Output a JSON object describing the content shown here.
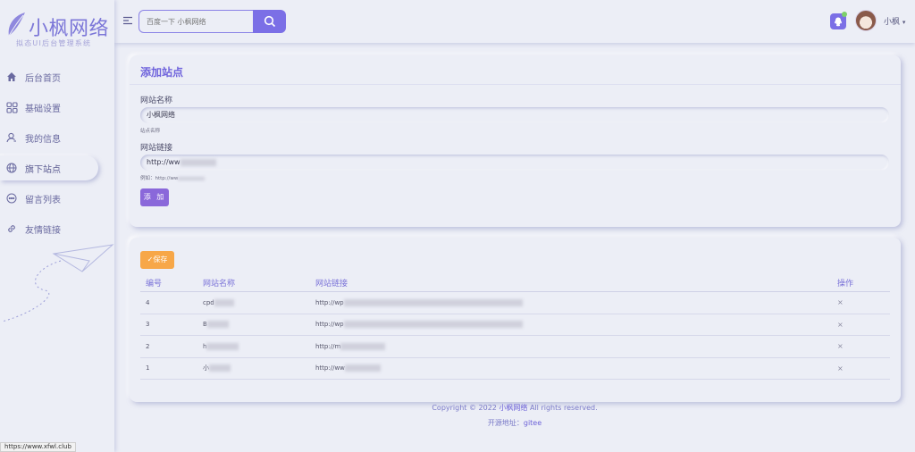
{
  "sidebar": {
    "logo_title": "小枫网络",
    "logo_subtitle": "拟态UI后台管理系统",
    "items": [
      {
        "label": "后台首页",
        "icon": "home-icon"
      },
      {
        "label": "基础设置",
        "icon": "grid-icon"
      },
      {
        "label": "我的信息",
        "icon": "user-icon"
      },
      {
        "label": "旗下站点",
        "icon": "globe-icon",
        "active": true
      },
      {
        "label": "留言列表",
        "icon": "message-icon"
      },
      {
        "label": "友情链接",
        "icon": "link-icon"
      }
    ]
  },
  "header": {
    "search_placeholder": "百度一下 小枫网络",
    "user_name": "小枫",
    "user_caret": "▾"
  },
  "form": {
    "title": "添加站点",
    "site_name_label": "网站名称",
    "site_name_value": "小枫网络",
    "site_name_help": "站点名称",
    "site_url_label": "网站链接",
    "site_url_value": "http://ww",
    "site_url_help": "例如：http://ww",
    "add_button": "添 加"
  },
  "table": {
    "save_button": "✓保存",
    "headers": {
      "id": "编号",
      "name": "网站名称",
      "url": "网站链接",
      "op": "操作"
    },
    "rows": [
      {
        "id": "4",
        "name": "cpd",
        "url": "http://wp",
        "op": "×"
      },
      {
        "id": "3",
        "name": "B",
        "url": "http://wp",
        "op": "×"
      },
      {
        "id": "2",
        "name": "h",
        "url": "http://m",
        "op": "×"
      },
      {
        "id": "1",
        "name": "小",
        "url": "http://ww",
        "op": "×"
      }
    ]
  },
  "footer": {
    "copyright_prefix": "Copyright © 2022",
    "copyright_brand": "小枫网络",
    "copyright_suffix": "All rights reserved.",
    "source_label": "开源地址：",
    "source_link": "gitee"
  },
  "status_bar": {
    "url": "https://www.xfwl.club"
  },
  "colors": {
    "accent": "#7b6fe6",
    "save": "#f7a748",
    "add": "#8a68da",
    "background": "#eceef6"
  }
}
